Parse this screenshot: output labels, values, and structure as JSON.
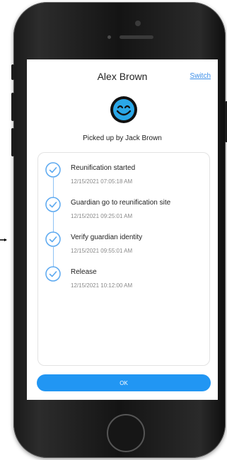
{
  "profile": {
    "name": "Alex Brown",
    "switch_label": "Switch",
    "avatar_icon": "smiley-face-icon",
    "picked_up_text": "Picked up by Jack Brown"
  },
  "timeline": [
    {
      "label": "Reunification started",
      "time": "12/15/2021 07:05:18 AM",
      "icon": "check-circle-icon"
    },
    {
      "label": "Guardian go to reunification site",
      "time": "12/15/2021 09:25:01 AM",
      "icon": "check-circle-icon"
    },
    {
      "label": "Verify guardian identity",
      "time": "12/15/2021 09:55:01 AM",
      "icon": "check-circle-icon"
    },
    {
      "label": "Release",
      "time": "12/15/2021 10:12:00 AM",
      "icon": "check-circle-icon"
    }
  ],
  "ok_button": {
    "label": "OK"
  },
  "colors": {
    "accent": "#2196f3",
    "link": "#3b8ee8",
    "check": "#5aa8f0",
    "avatar": "#111111"
  }
}
